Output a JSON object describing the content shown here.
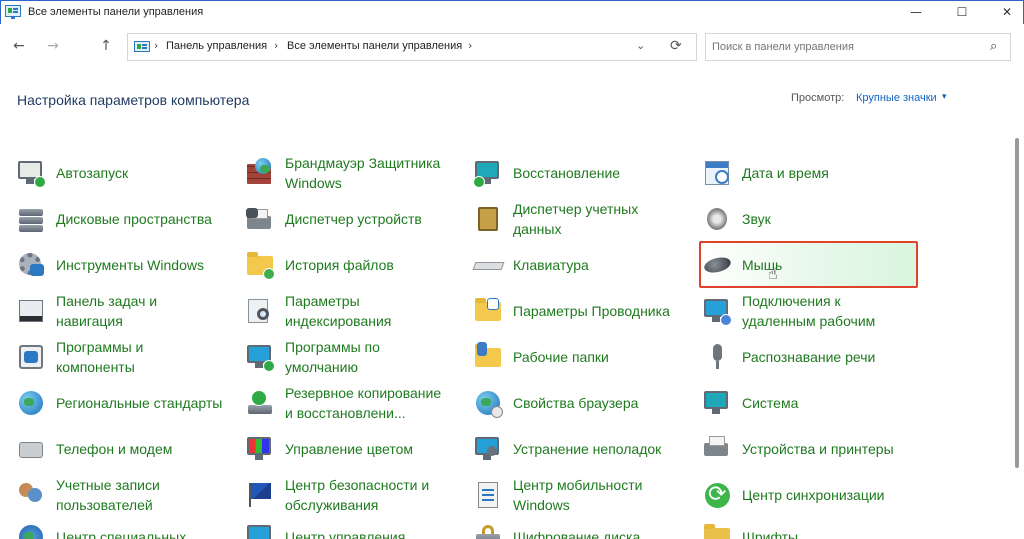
{
  "window": {
    "title": "Все элементы панели управления",
    "controls": {
      "minimize": "—",
      "maximize": "☐",
      "close": "✕"
    }
  },
  "nav": {
    "back": "←",
    "forward": "→",
    "up": "↑",
    "breadcrumbs": [
      "Панель управления",
      "Все элементы панели управления"
    ],
    "separator": "›",
    "dropdown": "⌄",
    "refresh": "⟳",
    "search_placeholder": "Поиск в панели управления",
    "search_glyph": "⌕"
  },
  "header": {
    "title": "Настройка параметров компьютера",
    "view_label": "Просмотр:",
    "view_value": "Крупные значки",
    "view_caret": "▾"
  },
  "items": [
    {
      "id": "autoplay",
      "icon": "autoplay-icon",
      "label": "Автозапуск"
    },
    {
      "id": "firewall",
      "icon": "firewall-icon",
      "label": "Брандмауэр Защитника\nWindows"
    },
    {
      "id": "recovery",
      "icon": "recovery-icon",
      "label": "Восстановление"
    },
    {
      "id": "datetime",
      "icon": "date-time-icon",
      "label": "Дата и время"
    },
    {
      "id": "storage-spaces",
      "icon": "storage-spaces-icon",
      "label": "Дисковые пространства"
    },
    {
      "id": "device-manager",
      "icon": "device-manager-icon",
      "label": "Диспетчер устройств"
    },
    {
      "id": "credential-manager",
      "icon": "credential-manager-icon",
      "label": "Диспетчер учетных\nданных"
    },
    {
      "id": "sound",
      "icon": "sound-icon",
      "label": "Звук"
    },
    {
      "id": "windows-tools",
      "icon": "windows-tools-icon",
      "label": "Инструменты Windows"
    },
    {
      "id": "file-history",
      "icon": "file-history-icon",
      "label": "История файлов"
    },
    {
      "id": "keyboard",
      "icon": "keyboard-icon",
      "label": "Клавиатура"
    },
    {
      "id": "mouse",
      "icon": "mouse-icon",
      "label": "Мышь"
    },
    {
      "id": "taskbar",
      "icon": "taskbar-icon",
      "label": "Панель задач и\nнавигация"
    },
    {
      "id": "indexing",
      "icon": "indexing-icon",
      "label": "Параметры\nиндексирования"
    },
    {
      "id": "explorer-options",
      "icon": "explorer-options-icon",
      "label": "Параметры Проводника"
    },
    {
      "id": "remote-desktop",
      "icon": "remote-desktop-icon",
      "label": "Подключения к\nудаленным рабочим"
    },
    {
      "id": "programs",
      "icon": "programs-icon",
      "label": "Программы и\nкомпоненты"
    },
    {
      "id": "default-programs",
      "icon": "default-programs-icon",
      "label": "Программы по\nумолчанию"
    },
    {
      "id": "work-folders",
      "icon": "work-folders-icon",
      "label": "Рабочие папки"
    },
    {
      "id": "speech",
      "icon": "speech-recognition-icon",
      "label": "Распознавание речи"
    },
    {
      "id": "region",
      "icon": "region-icon",
      "label": "Региональные стандарты"
    },
    {
      "id": "backup",
      "icon": "backup-icon",
      "label": "Резервное копирование\nи восстановлени..."
    },
    {
      "id": "internet-options",
      "icon": "internet-options-icon",
      "label": "Свойства браузера"
    },
    {
      "id": "system",
      "icon": "system-icon",
      "label": "Система"
    },
    {
      "id": "phone-modem",
      "icon": "phone-modem-icon",
      "label": "Телефон и модем"
    },
    {
      "id": "color-management",
      "icon": "color-management-icon",
      "label": "Управление цветом"
    },
    {
      "id": "troubleshooting",
      "icon": "troubleshooting-icon",
      "label": "Устранение неполадок"
    },
    {
      "id": "devices-printers",
      "icon": "devices-printers-icon",
      "label": "Устройства и принтеры"
    },
    {
      "id": "user-accounts",
      "icon": "user-accounts-icon",
      "label": "Учетные записи\nпользователей"
    },
    {
      "id": "security-center",
      "icon": "security-center-icon",
      "label": "Центр безопасности и\nобслуживания"
    },
    {
      "id": "mobility-center",
      "icon": "mobility-center-icon",
      "label": "Центр мобильности\nWindows"
    },
    {
      "id": "sync-center",
      "icon": "sync-center-icon",
      "label": "Центр синхронизации"
    },
    {
      "id": "ease-of-access",
      "icon": "ease-of-access-icon",
      "label": "Центр специальных"
    },
    {
      "id": "management",
      "icon": "management-icon",
      "label": "Центр управления"
    },
    {
      "id": "bitlocker",
      "icon": "bitlocker-icon",
      "label": "Шифрование диска"
    },
    {
      "id": "fonts",
      "icon": "fonts-icon",
      "label": "Шрифты"
    }
  ],
  "colors": {
    "link": "#1f7a1f",
    "highlight_border": "#e0432b",
    "view_link": "#1565c0",
    "title": "#1e3a5f"
  }
}
